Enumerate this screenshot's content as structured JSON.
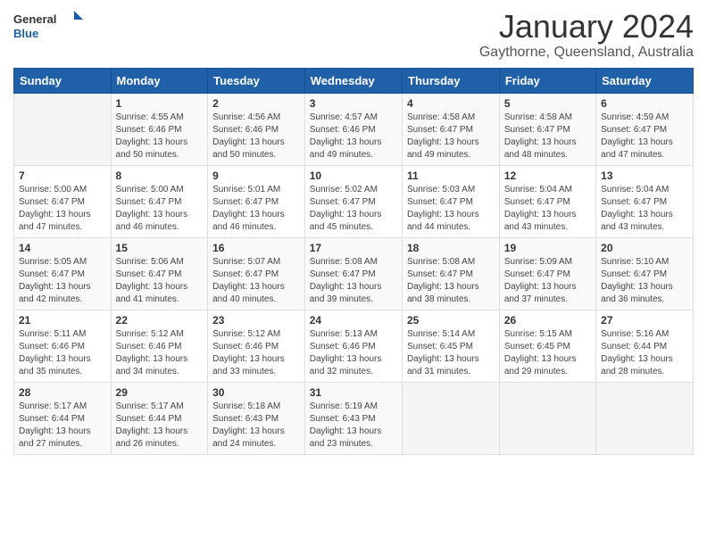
{
  "logo": {
    "line1": "General",
    "line2": "Blue"
  },
  "title": "January 2024",
  "subtitle": "Gaythorne, Queensland, Australia",
  "weekdays": [
    "Sunday",
    "Monday",
    "Tuesday",
    "Wednesday",
    "Thursday",
    "Friday",
    "Saturday"
  ],
  "weeks": [
    [
      {
        "day": "",
        "sunrise": "",
        "sunset": "",
        "daylight": ""
      },
      {
        "day": "1",
        "sunrise": "Sunrise: 4:55 AM",
        "sunset": "Sunset: 6:46 PM",
        "daylight": "Daylight: 13 hours and 50 minutes."
      },
      {
        "day": "2",
        "sunrise": "Sunrise: 4:56 AM",
        "sunset": "Sunset: 6:46 PM",
        "daylight": "Daylight: 13 hours and 50 minutes."
      },
      {
        "day": "3",
        "sunrise": "Sunrise: 4:57 AM",
        "sunset": "Sunset: 6:46 PM",
        "daylight": "Daylight: 13 hours and 49 minutes."
      },
      {
        "day": "4",
        "sunrise": "Sunrise: 4:58 AM",
        "sunset": "Sunset: 6:47 PM",
        "daylight": "Daylight: 13 hours and 49 minutes."
      },
      {
        "day": "5",
        "sunrise": "Sunrise: 4:58 AM",
        "sunset": "Sunset: 6:47 PM",
        "daylight": "Daylight: 13 hours and 48 minutes."
      },
      {
        "day": "6",
        "sunrise": "Sunrise: 4:59 AM",
        "sunset": "Sunset: 6:47 PM",
        "daylight": "Daylight: 13 hours and 47 minutes."
      }
    ],
    [
      {
        "day": "7",
        "sunrise": "Sunrise: 5:00 AM",
        "sunset": "Sunset: 6:47 PM",
        "daylight": "Daylight: 13 hours and 47 minutes."
      },
      {
        "day": "8",
        "sunrise": "Sunrise: 5:00 AM",
        "sunset": "Sunset: 6:47 PM",
        "daylight": "Daylight: 13 hours and 46 minutes."
      },
      {
        "day": "9",
        "sunrise": "Sunrise: 5:01 AM",
        "sunset": "Sunset: 6:47 PM",
        "daylight": "Daylight: 13 hours and 46 minutes."
      },
      {
        "day": "10",
        "sunrise": "Sunrise: 5:02 AM",
        "sunset": "Sunset: 6:47 PM",
        "daylight": "Daylight: 13 hours and 45 minutes."
      },
      {
        "day": "11",
        "sunrise": "Sunrise: 5:03 AM",
        "sunset": "Sunset: 6:47 PM",
        "daylight": "Daylight: 13 hours and 44 minutes."
      },
      {
        "day": "12",
        "sunrise": "Sunrise: 5:04 AM",
        "sunset": "Sunset: 6:47 PM",
        "daylight": "Daylight: 13 hours and 43 minutes."
      },
      {
        "day": "13",
        "sunrise": "Sunrise: 5:04 AM",
        "sunset": "Sunset: 6:47 PM",
        "daylight": "Daylight: 13 hours and 43 minutes."
      }
    ],
    [
      {
        "day": "14",
        "sunrise": "Sunrise: 5:05 AM",
        "sunset": "Sunset: 6:47 PM",
        "daylight": "Daylight: 13 hours and 42 minutes."
      },
      {
        "day": "15",
        "sunrise": "Sunrise: 5:06 AM",
        "sunset": "Sunset: 6:47 PM",
        "daylight": "Daylight: 13 hours and 41 minutes."
      },
      {
        "day": "16",
        "sunrise": "Sunrise: 5:07 AM",
        "sunset": "Sunset: 6:47 PM",
        "daylight": "Daylight: 13 hours and 40 minutes."
      },
      {
        "day": "17",
        "sunrise": "Sunrise: 5:08 AM",
        "sunset": "Sunset: 6:47 PM",
        "daylight": "Daylight: 13 hours and 39 minutes."
      },
      {
        "day": "18",
        "sunrise": "Sunrise: 5:08 AM",
        "sunset": "Sunset: 6:47 PM",
        "daylight": "Daylight: 13 hours and 38 minutes."
      },
      {
        "day": "19",
        "sunrise": "Sunrise: 5:09 AM",
        "sunset": "Sunset: 6:47 PM",
        "daylight": "Daylight: 13 hours and 37 minutes."
      },
      {
        "day": "20",
        "sunrise": "Sunrise: 5:10 AM",
        "sunset": "Sunset: 6:47 PM",
        "daylight": "Daylight: 13 hours and 36 minutes."
      }
    ],
    [
      {
        "day": "21",
        "sunrise": "Sunrise: 5:11 AM",
        "sunset": "Sunset: 6:46 PM",
        "daylight": "Daylight: 13 hours and 35 minutes."
      },
      {
        "day": "22",
        "sunrise": "Sunrise: 5:12 AM",
        "sunset": "Sunset: 6:46 PM",
        "daylight": "Daylight: 13 hours and 34 minutes."
      },
      {
        "day": "23",
        "sunrise": "Sunrise: 5:12 AM",
        "sunset": "Sunset: 6:46 PM",
        "daylight": "Daylight: 13 hours and 33 minutes."
      },
      {
        "day": "24",
        "sunrise": "Sunrise: 5:13 AM",
        "sunset": "Sunset: 6:46 PM",
        "daylight": "Daylight: 13 hours and 32 minutes."
      },
      {
        "day": "25",
        "sunrise": "Sunrise: 5:14 AM",
        "sunset": "Sunset: 6:45 PM",
        "daylight": "Daylight: 13 hours and 31 minutes."
      },
      {
        "day": "26",
        "sunrise": "Sunrise: 5:15 AM",
        "sunset": "Sunset: 6:45 PM",
        "daylight": "Daylight: 13 hours and 29 minutes."
      },
      {
        "day": "27",
        "sunrise": "Sunrise: 5:16 AM",
        "sunset": "Sunset: 6:44 PM",
        "daylight": "Daylight: 13 hours and 28 minutes."
      }
    ],
    [
      {
        "day": "28",
        "sunrise": "Sunrise: 5:17 AM",
        "sunset": "Sunset: 6:44 PM",
        "daylight": "Daylight: 13 hours and 27 minutes."
      },
      {
        "day": "29",
        "sunrise": "Sunrise: 5:17 AM",
        "sunset": "Sunset: 6:44 PM",
        "daylight": "Daylight: 13 hours and 26 minutes."
      },
      {
        "day": "30",
        "sunrise": "Sunrise: 5:18 AM",
        "sunset": "Sunset: 6:43 PM",
        "daylight": "Daylight: 13 hours and 24 minutes."
      },
      {
        "day": "31",
        "sunrise": "Sunrise: 5:19 AM",
        "sunset": "Sunset: 6:43 PM",
        "daylight": "Daylight: 13 hours and 23 minutes."
      },
      {
        "day": "",
        "sunrise": "",
        "sunset": "",
        "daylight": ""
      },
      {
        "day": "",
        "sunrise": "",
        "sunset": "",
        "daylight": ""
      },
      {
        "day": "",
        "sunrise": "",
        "sunset": "",
        "daylight": ""
      }
    ]
  ]
}
